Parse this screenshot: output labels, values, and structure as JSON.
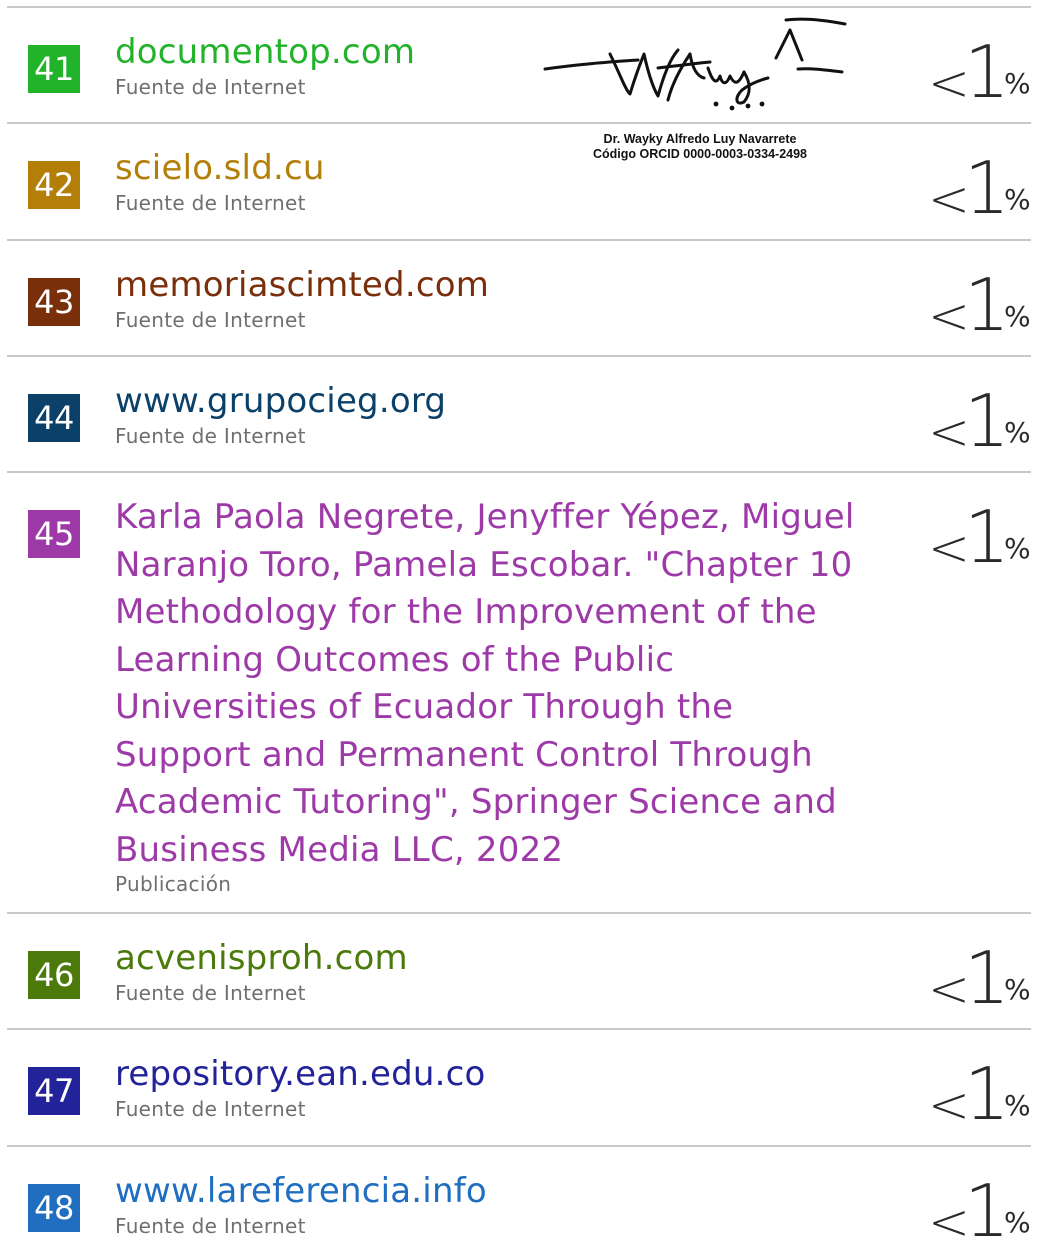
{
  "sources": [
    {
      "number": "41",
      "name": "documentop.com",
      "type": "Fuente de Internet",
      "color": "#21b32a",
      "percent_symbol": "<",
      "percent_value": "1",
      "percent_sign": "%"
    },
    {
      "number": "42",
      "name": "scielo.sld.cu",
      "type": "Fuente de Internet",
      "color": "#b47f09",
      "percent_symbol": "<",
      "percent_value": "1",
      "percent_sign": "%"
    },
    {
      "number": "43",
      "name": "memoriascimted.com",
      "type": "Fuente de Internet",
      "color": "#7a2f0b",
      "percent_symbol": "<",
      "percent_value": "1",
      "percent_sign": "%"
    },
    {
      "number": "44",
      "name": "www.grupocieg.org",
      "type": "Fuente de Internet",
      "color": "#0b4069",
      "percent_symbol": "<",
      "percent_value": "1",
      "percent_sign": "%"
    },
    {
      "number": "45",
      "name": "Karla Paola Negrete, Jenyffer Yépez, Miguel Naranjo Toro, Pamela Escobar. \"Chapter 10 Methodology for the Improvement of the Learning Outcomes of the Public Universities of Ecuador Through the Support and Permanent Control Through Academic Tutoring\", Springer Science and Business Media LLC, 2022",
      "type": "Publicación",
      "color": "#9d3aa8",
      "percent_symbol": "<",
      "percent_value": "1",
      "percent_sign": "%"
    },
    {
      "number": "46",
      "name": "acvenisproh.com",
      "type": "Fuente de Internet",
      "color": "#4b7a0a",
      "percent_symbol": "<",
      "percent_value": "1",
      "percent_sign": "%"
    },
    {
      "number": "47",
      "name": "repository.ean.edu.co",
      "type": "Fuente de Internet",
      "color": "#22229a",
      "percent_symbol": "<",
      "percent_value": "1",
      "percent_sign": "%"
    },
    {
      "number": "48",
      "name": "www.lareferencia.info",
      "type": "Fuente de Internet",
      "color": "#1f6ec0",
      "percent_symbol": "<",
      "percent_value": "1",
      "percent_sign": "%"
    }
  ],
  "signature": {
    "name": "Dr. Wayky Alfredo Luy Navarrete",
    "orcid_label": "Código ORCID",
    "orcid_value": "0000-0003-0334-2498",
    "signed_text": "W A Luy"
  }
}
